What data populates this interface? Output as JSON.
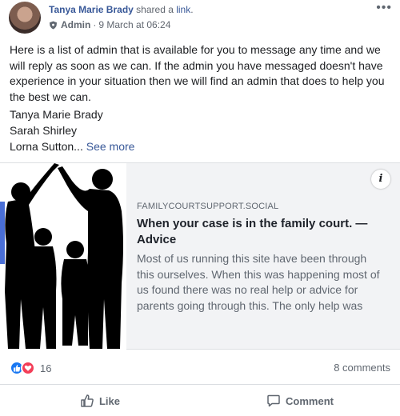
{
  "post": {
    "author": "Tanya Marie Brady",
    "action_text": "shared a",
    "action_link": "link",
    "action_end": ".",
    "role": "Admin",
    "separator": "·",
    "timestamp": "9 March at 06:24",
    "body": "Here is a list of admin that is available for you to message any time and we will reply as soon as we can. If the admin you have messaged doesn't have experience in your situation then we will find an admin that does to help you the best we can.",
    "names": [
      "Tanya Marie Brady",
      "Sarah Shirley",
      "Lorna Sutton"
    ],
    "ellipsis": "...",
    "see_more": "See more"
  },
  "link_card": {
    "domain": "FAMILYCOURTSUPPORT.SOCIAL",
    "title": "When your case is in the family court. — Advice",
    "description": "Most of us running this site have been through this ourselves. When this was happening most of us found there was no real help or advice for parents going through this. The only help was",
    "info_label": "i"
  },
  "stats": {
    "reaction_count": "16",
    "comments": "8 comments"
  },
  "actions": {
    "like": "Like",
    "comment": "Comment"
  },
  "colors": {
    "link_blue": "#385898",
    "like_blue": "#1877f2",
    "love_red": "#f33e58",
    "muted": "#606770"
  }
}
